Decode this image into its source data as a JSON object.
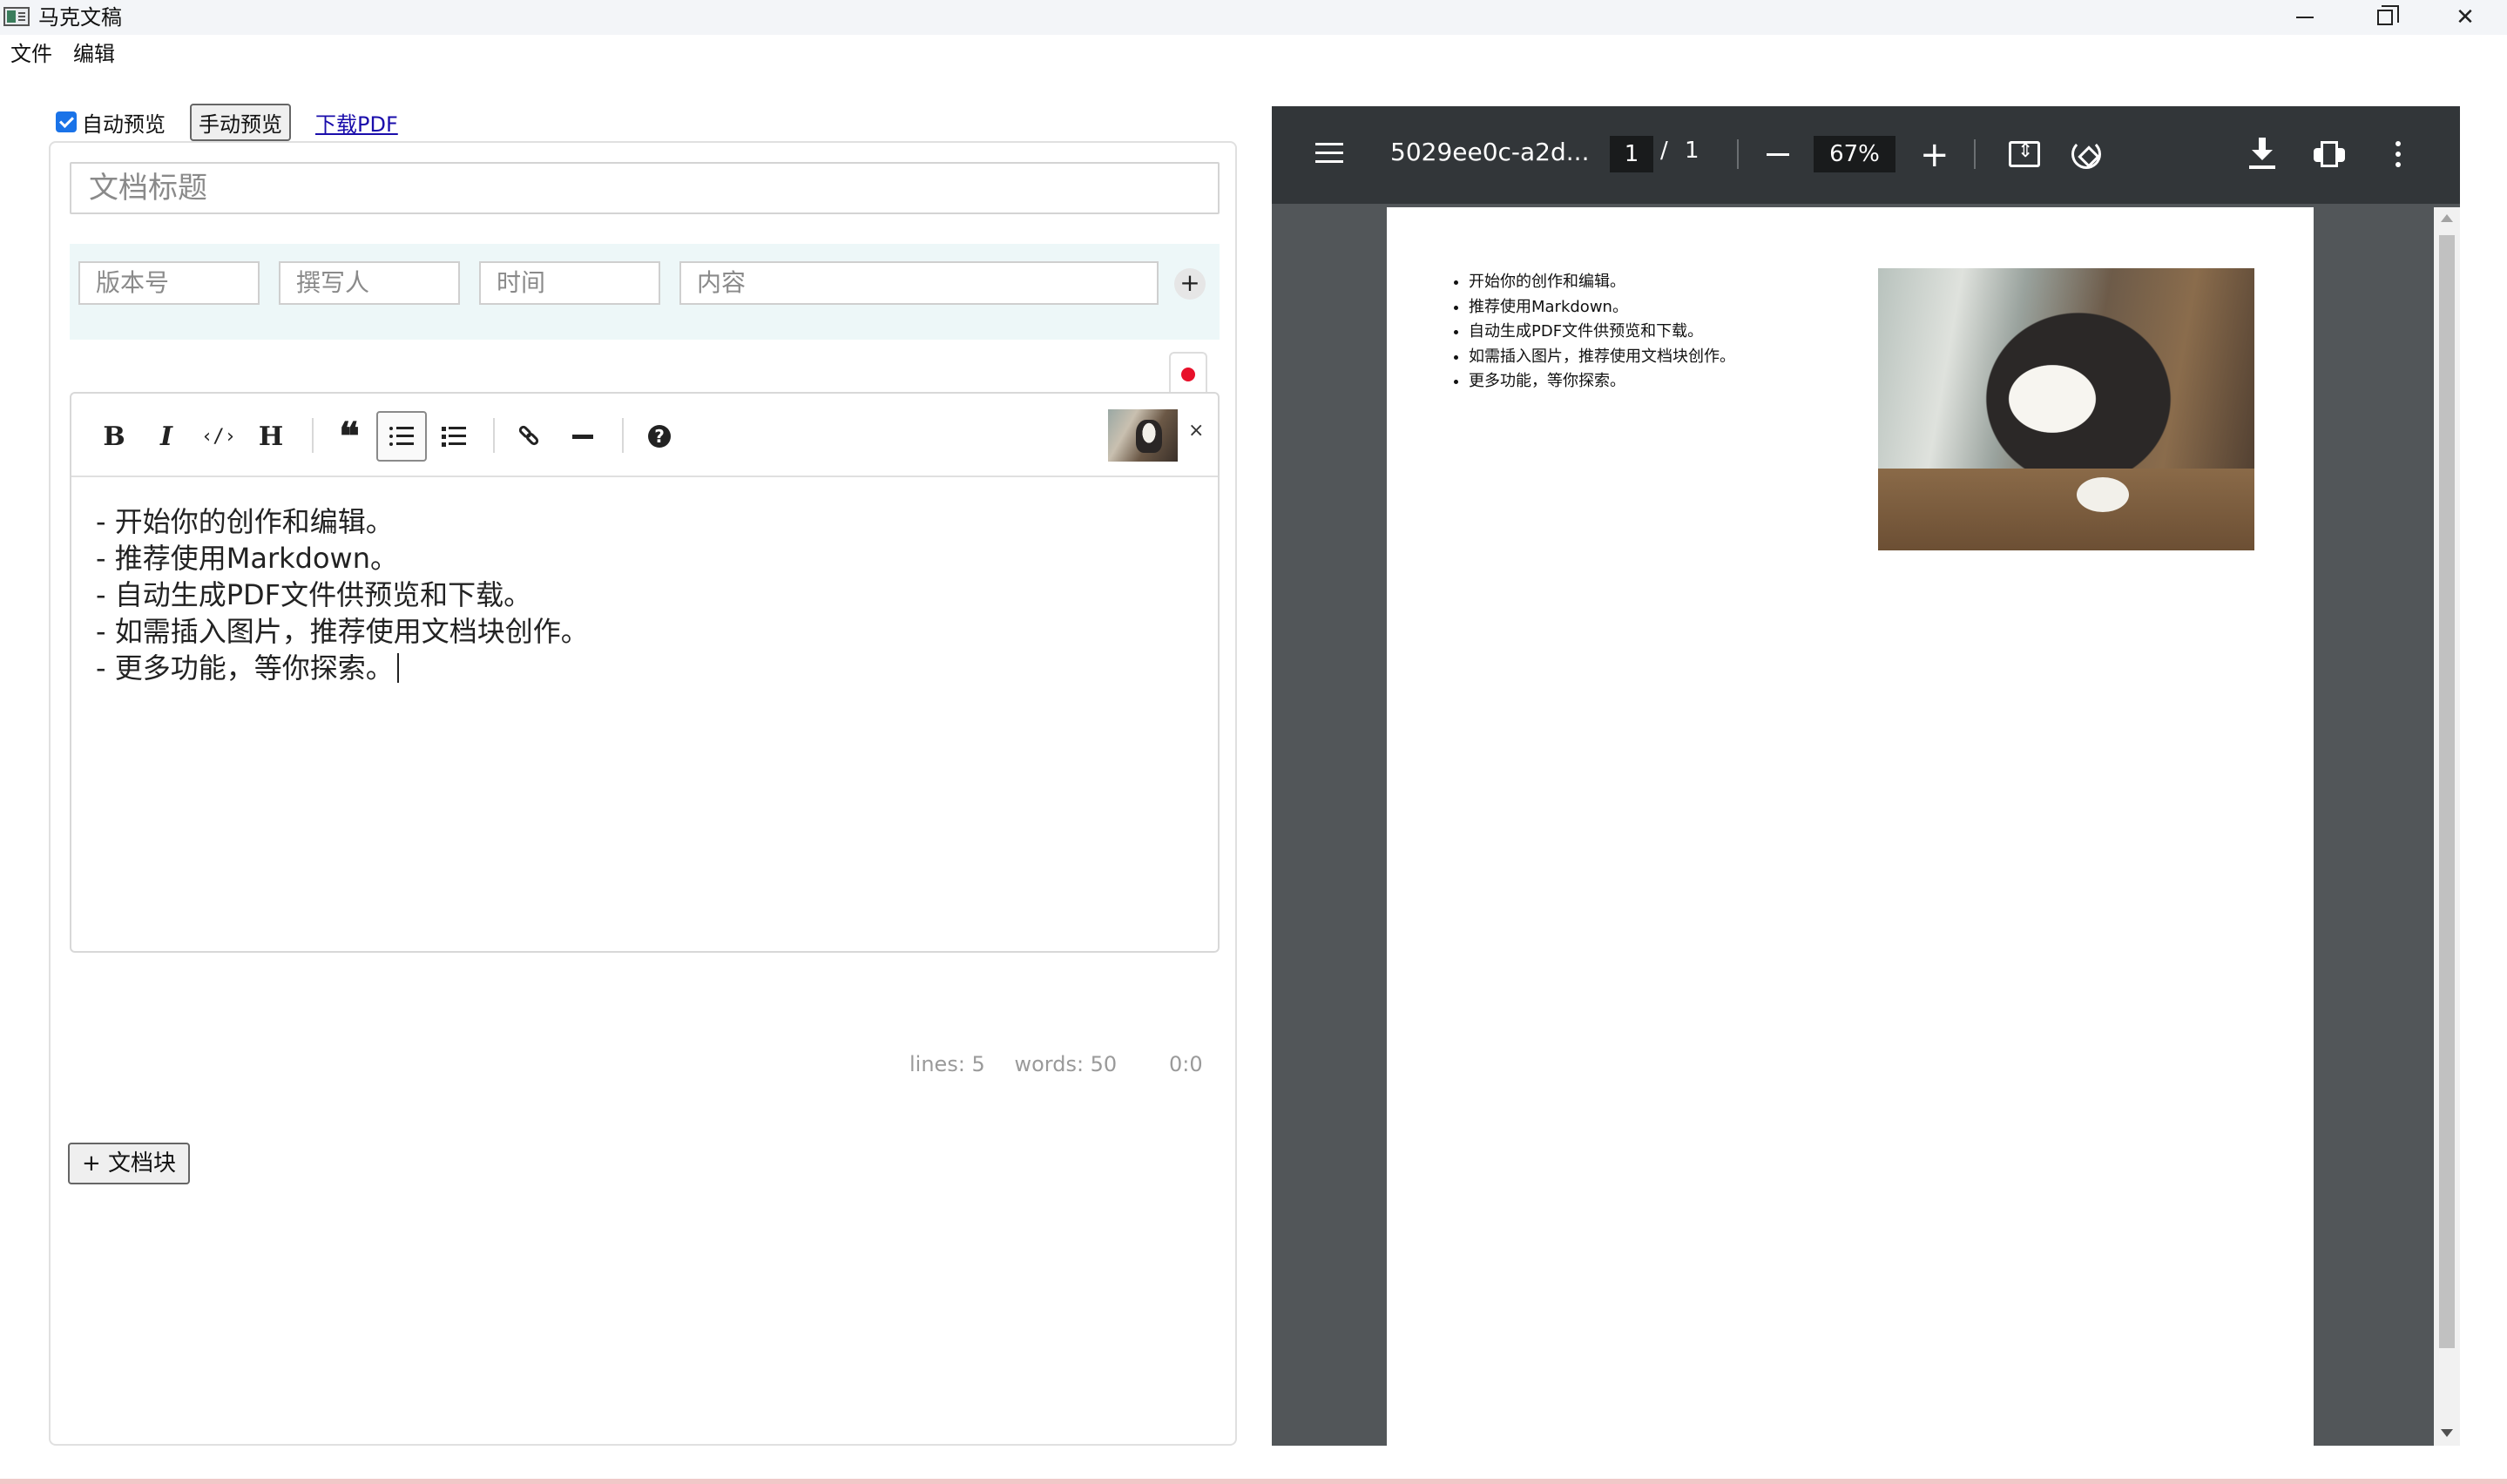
{
  "window": {
    "title": "马克文稿",
    "icon": "app-icon",
    "controls": [
      "minimize-icon",
      "maximize-icon",
      "close-icon"
    ],
    "close_glyph": "✕"
  },
  "menu": {
    "items": [
      "文件",
      "编辑"
    ]
  },
  "controls": {
    "auto_preview_label": "自动预览",
    "auto_preview_checked": true,
    "manual_preview_label": "手动预览",
    "download_pdf_label": "下载PDF"
  },
  "document": {
    "title_placeholder": "文档标题",
    "meta": {
      "version_placeholder": "版本号",
      "author_placeholder": "撰写人",
      "time_placeholder": "时间",
      "content_placeholder": "内容",
      "add_label": "+"
    }
  },
  "editor": {
    "toolbar": {
      "bold": "B",
      "italic": "I",
      "code": "‹/›",
      "heading": "H",
      "quote": "❝",
      "active": "unordered-list"
    },
    "thumbnail_close": "×",
    "lines": [
      "- 开始你的创作和编辑。",
      "- 推荐使用Markdown。",
      "- 自动生成PDF文件供预览和下载。",
      "- 如需插入图片，推荐使用文档块创作。",
      "- 更多功能，等你探索。"
    ],
    "status": {
      "lines": "lines: 5",
      "words": "words: 50",
      "cursor": "0:0"
    }
  },
  "add_block_label": "+ 文档块",
  "pdf": {
    "filename": "5029ee0c-a2d...",
    "page_current": "1",
    "page_separator": "/",
    "page_total": "1",
    "zoom": "67%",
    "plus": "+",
    "items": [
      "开始你的创作和编辑。",
      "推荐使用Markdown。",
      "自动生成PDF文件供预览和下载。",
      "如需插入图片，推荐使用文档块创作。",
      "更多功能，等你探索。"
    ],
    "colors": {
      "toolbar": "#323639",
      "background": "#525659"
    }
  }
}
